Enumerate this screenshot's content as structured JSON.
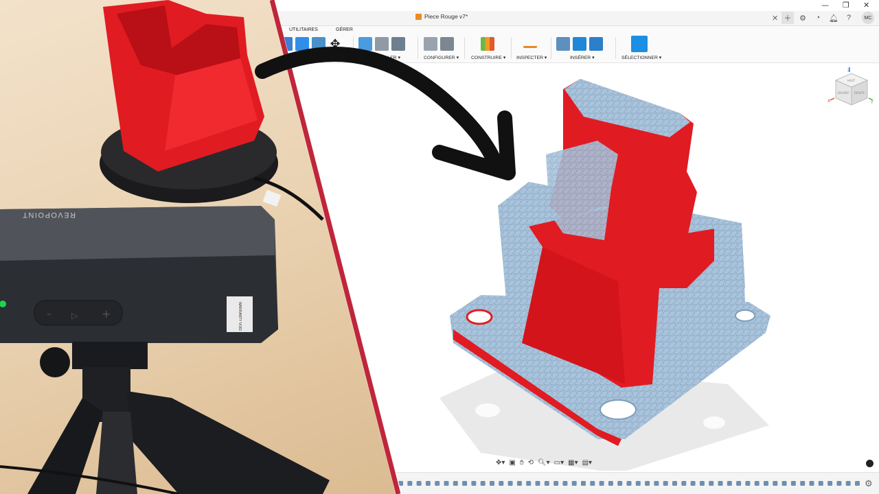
{
  "window": {
    "doc_title": "Piece Rouge v7*",
    "close_glyph": "✕",
    "minimize_glyph": "—",
    "restore_glyph": "❐",
    "avatar_initials": "MC"
  },
  "toolbar": {
    "tabs": [
      "UTILITAIRES",
      "GÉRER"
    ],
    "groups": [
      {
        "label": "ASSEMBLER ▾"
      },
      {
        "label": "CONFIGURER ▾"
      },
      {
        "label": "CONSTRUIRE ▾"
      },
      {
        "label": "INSPECTER ▾"
      },
      {
        "label": "INSÉRER ▾"
      },
      {
        "label": "SÉLECTIONNER ▾"
      }
    ]
  },
  "viewcube": {
    "axis_z": "Z",
    "axis_x": "X",
    "axis_y": "Y",
    "face_top": "HAUT",
    "face_front": "DEVANT",
    "face_right": "DROITE"
  },
  "photo": {
    "scanner_brand": "REVOPOINT",
    "warranty_label": "WARRANTY VOID"
  },
  "colors": {
    "accent_red": "#e11b22",
    "mesh_blue": "#a9c4dc",
    "divider": "#c0263a",
    "fusion_orange": "#f08a24",
    "select_blue": "#1a8fe3"
  },
  "icons": [
    "search-icon",
    "hand-icon",
    "orbit-icon",
    "zoom-icon",
    "display-icon",
    "grid-icon",
    "gear-icon",
    "bell-icon",
    "help-icon",
    "clock-icon"
  ]
}
